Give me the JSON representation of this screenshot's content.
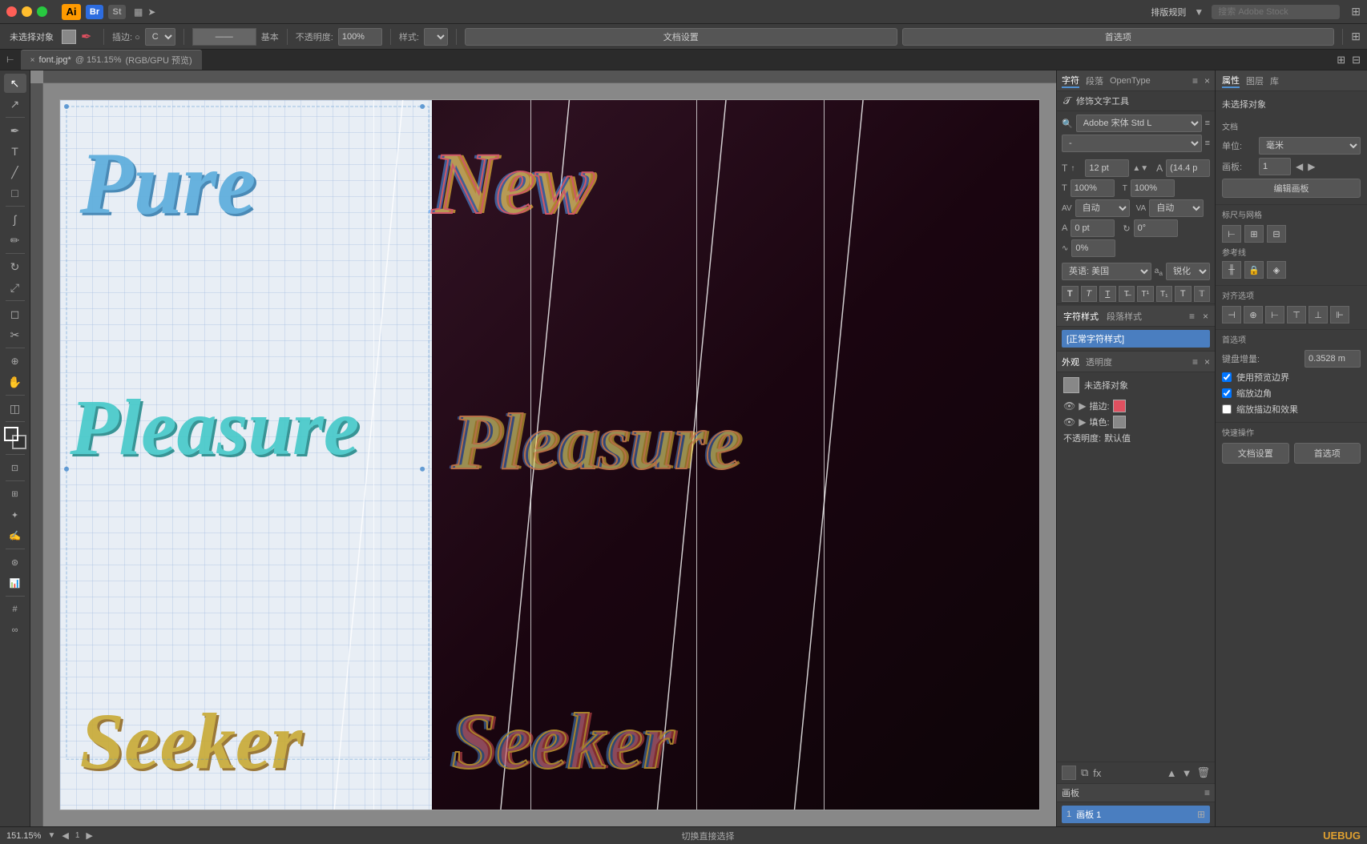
{
  "titlebar": {
    "app_name": "Ai",
    "traffic_lights": [
      "red",
      "yellow",
      "green"
    ],
    "app_icons": [
      {
        "label": "Ai",
        "color": "#ff9a00"
      },
      {
        "label": "Br",
        "color": "#2d6cdf"
      },
      {
        "label": "St",
        "color": "#555"
      }
    ],
    "menu_right": "排版规则",
    "search_placeholder": "搜索 Adobe Stock"
  },
  "toolbar": {
    "no_selection": "未选择对象",
    "stroke_label": "描边:",
    "interpolation_label": "插边: ○",
    "base_label": "基本",
    "opacity_label": "不透明度:",
    "opacity_value": "100%",
    "style_label": "样式:",
    "doc_settings": "文档设置",
    "preferences": "首选项"
  },
  "doctab": {
    "filename": "font.jpg*",
    "zoom": "151.15%",
    "color_mode": "RGB/GPU 预览",
    "close_label": "×"
  },
  "tools": [
    {
      "name": "select-tool",
      "icon": "↖",
      "title": "选择工具"
    },
    {
      "name": "direct-select-tool",
      "icon": "↗",
      "title": "直接选择"
    },
    {
      "name": "pen-tool",
      "icon": "✒",
      "title": "钢笔工具"
    },
    {
      "name": "type-tool",
      "icon": "T",
      "title": "文字工具"
    },
    {
      "name": "line-tool",
      "icon": "╱",
      "title": "直线工具"
    },
    {
      "name": "shape-tool",
      "icon": "□",
      "title": "形状工具"
    },
    {
      "name": "brush-tool",
      "icon": "∫",
      "title": "画笔工具"
    },
    {
      "name": "pencil-tool",
      "icon": "✏",
      "title": "铅笔工具"
    },
    {
      "name": "rotate-tool",
      "icon": "↻",
      "title": "旋转工具"
    },
    {
      "name": "scale-tool",
      "icon": "⤢",
      "title": "缩放工具"
    },
    {
      "name": "eraser-tool",
      "icon": "◻",
      "title": "橡皮擦"
    },
    {
      "name": "scissors-tool",
      "icon": "✂",
      "title": "剪刀工具"
    },
    {
      "name": "zoom-tool",
      "icon": "🔍",
      "title": "缩放"
    },
    {
      "name": "hand-tool",
      "icon": "✋",
      "title": "抓手工具"
    },
    {
      "name": "gradient-tool",
      "icon": "◫",
      "title": "渐变工具"
    },
    {
      "name": "fill-color",
      "icon": "■",
      "title": "填色"
    },
    {
      "name": "stroke-color",
      "icon": "□",
      "title": "描边色"
    }
  ],
  "character_panel": {
    "tabs": [
      "字符",
      "段落",
      "OpenType"
    ],
    "font_name": "Adobe 宋体 Std L",
    "font_style": "-",
    "size_label": "字体大小",
    "size_value": "12 pt",
    "leading_label": "行距",
    "leading_value": "(14.4 p",
    "scale_h_label": "水平缩放",
    "scale_h_value": "100%",
    "scale_v_label": "垂直缩放",
    "scale_v_value": "100%",
    "tracking_label": "字距",
    "tracking_value": "自动",
    "kerning_label": "字距调整",
    "kerning_value": "自动",
    "baseline_label": "基线偏移",
    "baseline_value": "0 pt",
    "rotate_label": "旋转",
    "rotate_value": "0°",
    "skew_value": "0%",
    "language": "英语: 美国",
    "anti_alias": "锐化",
    "char_style_label": "字符样式",
    "para_style_label": "段落样式",
    "current_style": "[正常字符样式]"
  },
  "appearance_panel": {
    "title": "外观",
    "transparency_title": "透明度",
    "no_selection": "未选择对象",
    "stroke_label": "描边:",
    "fill_label": "填色:",
    "opacity_label": "不透明度:",
    "opacity_value": "默认值",
    "stroke_color": "#e05060",
    "fill_color": "#888888"
  },
  "properties_panel": {
    "title": "属性",
    "tabs": [
      "属性",
      "图层",
      "库"
    ],
    "no_selection": "未选择对象",
    "document_section": "文档",
    "unit_label": "单位:",
    "unit_value": "毫米",
    "artboard_label": "画板:",
    "artboard_value": "1",
    "edit_artboard_btn": "编辑画板",
    "rulers_grids": "标尺与网格",
    "guides_label": "参考线",
    "align_label": "对齐选项",
    "prefs_label": "首选项",
    "keyboard_increment": "键盘增量:",
    "keyboard_value": "0.3528 m",
    "use_preview_bounds": "使用预览边界",
    "scale_corners": "缩放边角",
    "scale_stroke": "缩放描边和效果",
    "quick_actions": "快速操作",
    "doc_settings_btn": "文档设置",
    "prefs_btn": "首选项"
  },
  "artboards": [
    {
      "num": "1",
      "name": "画板 1"
    }
  ],
  "statusbar": {
    "zoom": "151.15%",
    "nav_prev": "◀",
    "nav_next": "▶",
    "status_text": "切换直接选择",
    "watermark": "UEBUG"
  },
  "canvas": {
    "text1_line1": "Pure",
    "text1_line2": "New",
    "text2": "Pleasure",
    "text3": "Seeker",
    "zoom_level": "151.15%"
  }
}
